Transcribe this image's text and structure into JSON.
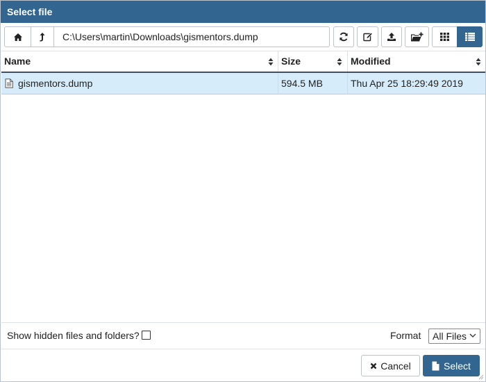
{
  "dialog": {
    "title": "Select file"
  },
  "toolbar": {
    "path_value": "C:\\Users\\martin\\Downloads\\gismentors.dump",
    "view_mode": "list"
  },
  "table": {
    "columns": [
      "Name",
      "Size",
      "Modified"
    ],
    "rows": [
      {
        "name": "gismentors.dump",
        "size": "594.5 MB",
        "modified": "Thu Apr 25 18:29:49 2019",
        "selected": true
      }
    ]
  },
  "options": {
    "show_hidden_label": "Show hidden files and folders?",
    "show_hidden_checked": false,
    "format_label": "Format",
    "format_selected": "All Files"
  },
  "footer": {
    "cancel_label": "Cancel",
    "select_label": "Select"
  },
  "colors": {
    "accent": "#326690",
    "selected_row": "#d6ecfa",
    "header_border": "#3d4f63"
  }
}
